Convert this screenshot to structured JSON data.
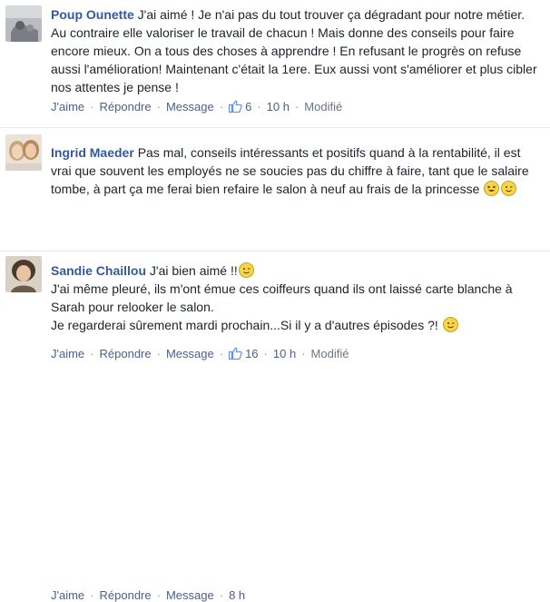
{
  "comments": [
    {
      "author": "Poup Ounette",
      "text": "J'ai aimé ! Je n'ai pas du tout trouver ça dégradant pour notre métier. Au contraire elle valoriser le travail de chacun ! Mais donne des conseils pour faire encore mieux. On a tous des choses à apprendre ! En refusant le progrès on refuse aussi l'amélioration! Maintenant c'était la 1ere. Eux aussi vont s'améliorer et plus cibler nos attentes je pense !",
      "actions": {
        "like": "J'aime",
        "reply": "Répondre",
        "message": "Message"
      },
      "like_count": "6",
      "time": "10 h",
      "edited": "Modifié"
    },
    {
      "author": "Ingrid Maeder",
      "text": "Pas mal, conseils intéressants et positifs quand à la rentabilité, il est vrai que souvent les employés ne se soucies pas du chiffre à faire, tant que le salaire tombe, à part ça me ferai bien refaire le salon à neuf au frais de la princesse",
      "actions": {
        "like": "J'aime",
        "reply": "Répondre",
        "message": "Message"
      },
      "like_count": "16",
      "time": "10 h",
      "edited": "Modifié"
    },
    {
      "author": "Sandie Chaillou",
      "text_line1": "J'ai bien aimé !!",
      "text_para2": "J'ai même pleuré, ils m'ont émue ces coiffeurs quand ils ont laissé carte blanche à Sarah pour relooker le salon.",
      "text_para3": "Je regarderai sûrement mardi prochain...Si il y a d'autres épisodes ?!",
      "actions": {
        "like": "J'aime",
        "reply": "Répondre",
        "message": "Message"
      },
      "time": "8 h"
    }
  ],
  "icons": {
    "like": "thumbs-up-icon",
    "emoji_laugh": "laughing-emoji-icon",
    "emoji_wink": "winking-emoji-icon"
  },
  "colors": {
    "author": "#365899",
    "link": "#4b5f8d",
    "meta": "#90949c",
    "like_icon": "#5890ff"
  }
}
